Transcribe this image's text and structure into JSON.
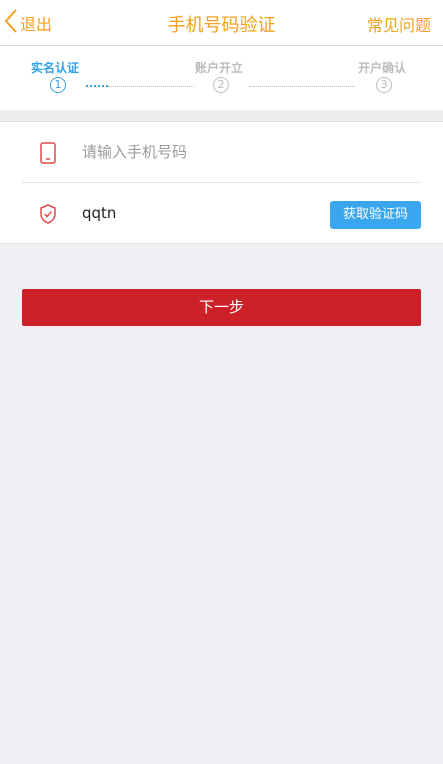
{
  "header": {
    "back_label": "退出",
    "title": "手机号码验证",
    "faq_label": "常见问题"
  },
  "steps": [
    {
      "label": "实名认证",
      "number": "1",
      "state": "active"
    },
    {
      "label": "账户开立",
      "number": "2",
      "state": "inactive"
    },
    {
      "label": "开户确认",
      "number": "3",
      "state": "inactive"
    }
  ],
  "form": {
    "phone": {
      "icon": "phone-icon",
      "placeholder": "请输入手机号码",
      "value": ""
    },
    "code": {
      "icon": "shield-check-icon",
      "value": "qqtn",
      "button_label": "获取验证码"
    }
  },
  "next_button_label": "下一步",
  "colors": {
    "accent_orange": "#f4a01d",
    "active_blue": "#35a2e8",
    "inactive_gray": "#bdbdbd",
    "primary_red": "#cc2128",
    "sms_button_blue": "#3aa6ee",
    "icon_red": "#e04b4b"
  }
}
